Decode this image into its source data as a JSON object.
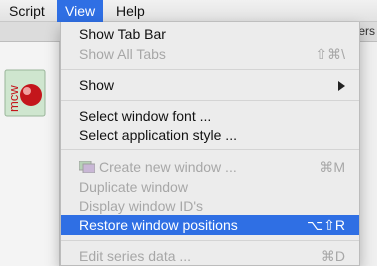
{
  "menubar": {
    "items": [
      {
        "label": "Script"
      },
      {
        "label": "View"
      },
      {
        "label": "Help"
      }
    ]
  },
  "background": {
    "partial_text": "vers",
    "logo_text": "mcw"
  },
  "view_menu": {
    "items": [
      {
        "label": "Show Tab Bar",
        "shortcut": "",
        "enabled": true
      },
      {
        "label": "Show All Tabs",
        "shortcut": "⇧⌘\\",
        "enabled": false
      },
      {
        "label": "Show",
        "shortcut": "",
        "enabled": true,
        "submenu": true
      },
      {
        "label": "Select window font ...",
        "shortcut": "",
        "enabled": true
      },
      {
        "label": "Select application style ...",
        "shortcut": "",
        "enabled": true
      },
      {
        "label": "Create new window ...",
        "shortcut": "⌘M",
        "enabled": false
      },
      {
        "label": "Duplicate window",
        "shortcut": "",
        "enabled": false
      },
      {
        "label": "Display window ID's",
        "shortcut": "",
        "enabled": false
      },
      {
        "label": "Restore window positions",
        "shortcut": "⌥⇧R",
        "enabled": true,
        "selected": true
      },
      {
        "label": "Edit series data ...",
        "shortcut": "⌘D",
        "enabled": false
      }
    ]
  },
  "colors": {
    "selection": "#2f6fe4",
    "menu_bg": "#ececec",
    "disabled_text": "#a7a7a7"
  }
}
